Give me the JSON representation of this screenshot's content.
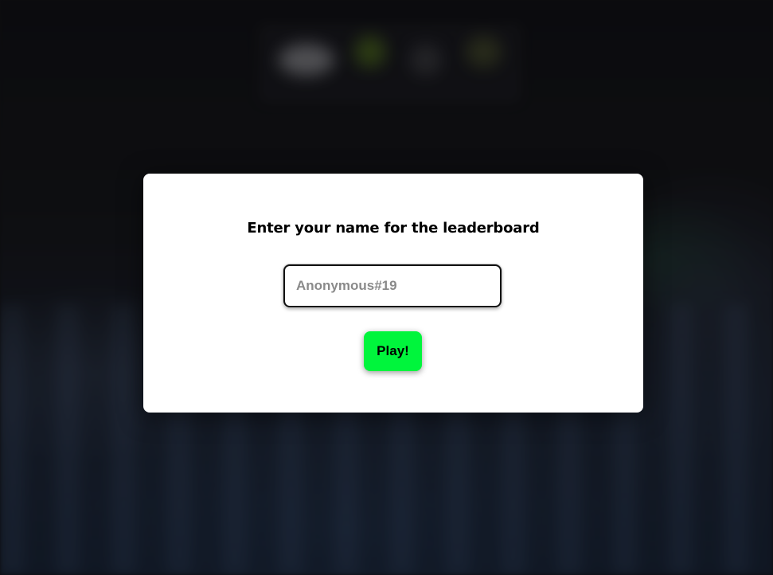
{
  "dialog": {
    "title": "Enter your name for the leaderboard",
    "name_input": {
      "value": "",
      "placeholder": "Anonymous#19"
    },
    "play_label": "Play!"
  },
  "colors": {
    "play_button": "#00f53c",
    "dialog_background": "#ffffff",
    "page_background": "#141418"
  }
}
